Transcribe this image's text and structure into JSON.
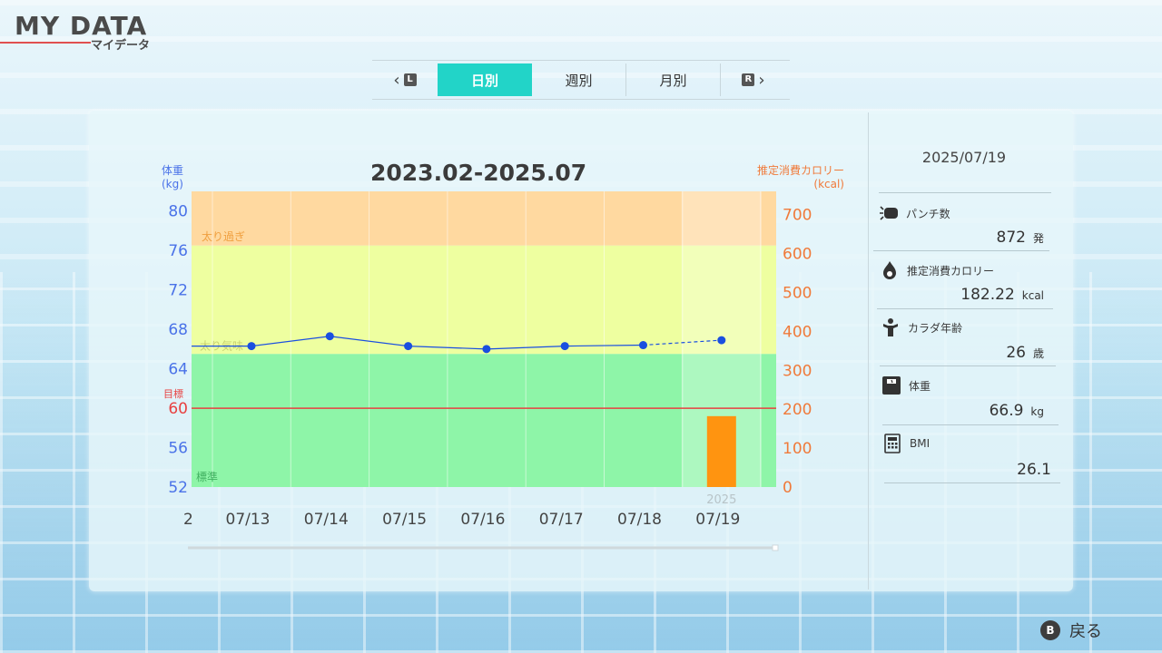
{
  "header": {
    "title_en": "MY DATA",
    "title_jp": "マイデータ"
  },
  "tabs": {
    "prev_button": "L",
    "next_button": "R",
    "items": [
      {
        "label": "日別",
        "active": true
      },
      {
        "label": "週別",
        "active": false
      },
      {
        "label": "月別",
        "active": false
      }
    ]
  },
  "chart": {
    "title": "2023.02-2025.07",
    "left_axis_label": [
      "体重",
      "(kg)"
    ],
    "right_axis_label": [
      "推定消費カロリー",
      "(kcal)"
    ],
    "target_label": "目標",
    "zone_labels": {
      "over": "太り過ぎ",
      "slight": "太り気味",
      "normal": "標準"
    },
    "year_label": "2025",
    "edge_label": "2",
    "colors": {
      "over": "#ffd9a0",
      "slight": "#eeffa0",
      "normal": "#8ef5a8",
      "weight_line": "#1a4fe0",
      "calorie_bar": "#ff9410",
      "target_line": "#e84040"
    }
  },
  "chart_data": {
    "type": "line",
    "x": [
      "07/13",
      "07/14",
      "07/15",
      "07/16",
      "07/17",
      "07/18",
      "07/19"
    ],
    "series": [
      {
        "axis": "left",
        "values": [
          66.3,
          67.3,
          66.3,
          66.0,
          66.3,
          66.4,
          66.9
        ]
      },
      {
        "axis": "right",
        "style": "bar",
        "values": [
          0,
          0,
          0,
          0,
          0,
          0,
          182.22
        ]
      }
    ],
    "y_left": {
      "ticks": [
        80,
        76,
        72,
        68,
        64,
        60,
        56,
        52
      ],
      "lim": [
        52,
        82
      ],
      "target": 60
    },
    "y_right": {
      "ticks": [
        700,
        600,
        500,
        400,
        300,
        200,
        100,
        0
      ],
      "lim": [
        0,
        760
      ]
    },
    "zones": {
      "over_above": 76.5,
      "slight_above": 65.5
    },
    "extra_left_point": 66.3
  },
  "detail": {
    "date": "2025/07/19",
    "rows": [
      {
        "label": "パンチ数",
        "value": "872",
        "unit": "発",
        "icon": "punch-icon"
      },
      {
        "label": "推定消費カロリー",
        "value": "182.22",
        "unit": "kcal",
        "icon": "flame-icon"
      },
      {
        "label": "カラダ年齢",
        "value": "26",
        "unit": "歳",
        "icon": "body-icon"
      },
      {
        "label": "体重",
        "value": "66.9",
        "unit": "kg",
        "icon": "scale-icon"
      },
      {
        "label": "BMI",
        "value": "26.1",
        "unit": "",
        "icon": "calculator-icon"
      }
    ]
  },
  "footer": {
    "back_button_glyph": "B",
    "back_label": "戻る"
  }
}
